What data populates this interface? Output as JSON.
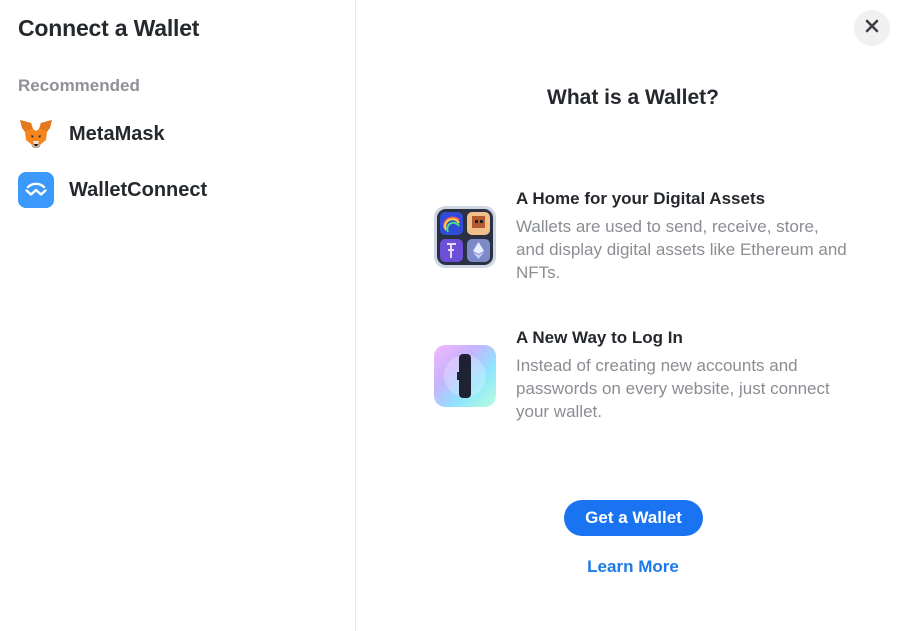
{
  "left": {
    "title": "Connect a Wallet",
    "section_label": "Recommended",
    "wallets": [
      {
        "label": "MetaMask",
        "icon": "metamask-fox-icon"
      },
      {
        "label": "WalletConnect",
        "icon": "walletconnect-icon"
      }
    ]
  },
  "right": {
    "close_icon": "close-icon",
    "title": "What is a Wallet?",
    "features": [
      {
        "heading": "A Home for your Digital Assets",
        "description": "Wallets are used to send, receive, store, and display digital assets like Ethereum and NFTs.",
        "icon": "digital-assets-icon"
      },
      {
        "heading": "A New Way to Log In",
        "description": "Instead of creating new accounts and passwords on every website, just connect your wallet.",
        "icon": "login-key-icon"
      }
    ],
    "primary_button": "Get a Wallet",
    "secondary_link": "Learn More"
  },
  "colors": {
    "accent": "#1a73f0",
    "link": "#1a7ae8",
    "muted_text": "#8a8d92",
    "walletconnect_blue": "#3b99fc"
  }
}
